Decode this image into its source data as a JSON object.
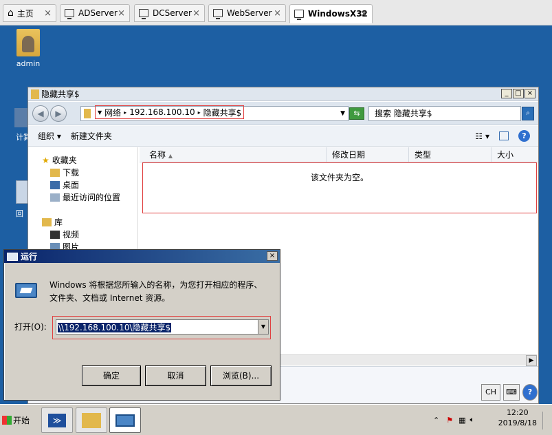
{
  "tabs": [
    {
      "label": "主页",
      "icon": "home-icon"
    },
    {
      "label": "ADServer",
      "icon": "vm-icon"
    },
    {
      "label": "DCServer",
      "icon": "vm-icon"
    },
    {
      "label": "WebServer",
      "icon": "vm-icon"
    },
    {
      "label": "WindowsX32",
      "icon": "vm-icon",
      "active": true
    }
  ],
  "desktop": {
    "icons": [
      {
        "label": "admin"
      },
      {
        "label": "计算"
      },
      {
        "label": "回"
      }
    ]
  },
  "explorer": {
    "title": "隐藏共享$",
    "address": {
      "seg1": "网络",
      "seg2": "192.168.100.10",
      "seg3": "隐藏共享$"
    },
    "search_placeholder": "搜索 隐藏共享$",
    "toolbar": {
      "organize": "组织",
      "new_folder": "新建文件夹"
    },
    "nav": {
      "favorites": "收藏夹",
      "downloads": "下载",
      "desktop": "桌面",
      "recent": "最近访问的位置",
      "libraries": "库",
      "videos": "视频",
      "pictures": "图片"
    },
    "columns": {
      "name": "名称",
      "modified": "修改日期",
      "type": "类型",
      "size": "大小"
    },
    "empty_message": "该文件夹为空。"
  },
  "run": {
    "title": "运行",
    "desc": "Windows 将根据您所输入的名称，为您打开相应的程序、文件夹、文档或 Internet 资源。",
    "open_label": "打开(O):",
    "open_value": "\\\\192.168.100.10\\隐藏共享$",
    "ok": "确定",
    "cancel": "取消",
    "browse": "浏览(B)..."
  },
  "taskbar": {
    "start": "开始",
    "time": "12:20",
    "date": "2019/8/18",
    "lang": "CH"
  }
}
